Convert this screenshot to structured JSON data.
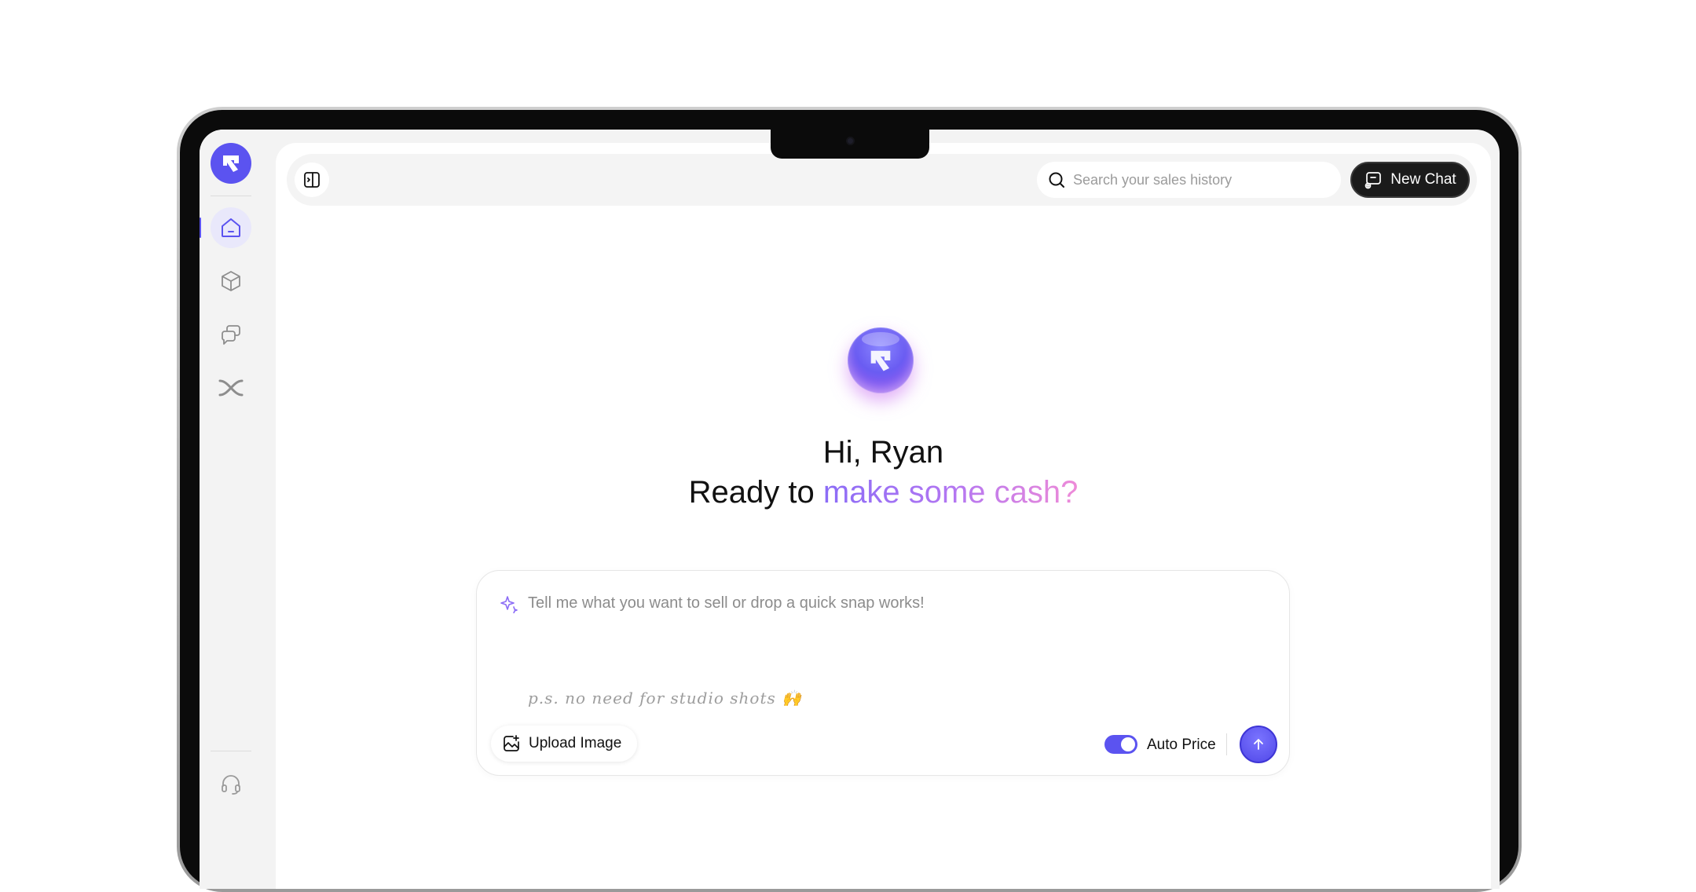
{
  "colors": {
    "accent": "#5b53f0",
    "dark": "#1b1b1b",
    "gradient_start": "#8b6cf6",
    "gradient_end": "#ee8bd8"
  },
  "sidebar": {
    "logo_icon": "arrow-up-right-logo-icon",
    "items": [
      {
        "name": "home",
        "icon": "home-icon",
        "active": true
      },
      {
        "name": "products",
        "icon": "cube-icon",
        "active": false
      },
      {
        "name": "chats",
        "icon": "chat-bubbles-icon",
        "active": false
      },
      {
        "name": "integrations",
        "icon": "shuffle-icon",
        "active": false
      }
    ],
    "support_icon": "headset-icon"
  },
  "header": {
    "toggle_icon": "sidebar-toggle-icon",
    "search": {
      "placeholder": "Search your sales history",
      "value": ""
    },
    "new_chat_label": "New Chat"
  },
  "hero": {
    "greeting": "Hi, Ryan",
    "tagline_prefix": "Ready to ",
    "tagline_highlight": "make some cash?"
  },
  "composer": {
    "placeholder": "Tell me what you want to sell or drop a quick snap works!",
    "hint": "p.s. no need for studio shots 🙌",
    "upload_label": "Upload Image",
    "auto_price_label": "Auto Price",
    "auto_price_on": true
  }
}
